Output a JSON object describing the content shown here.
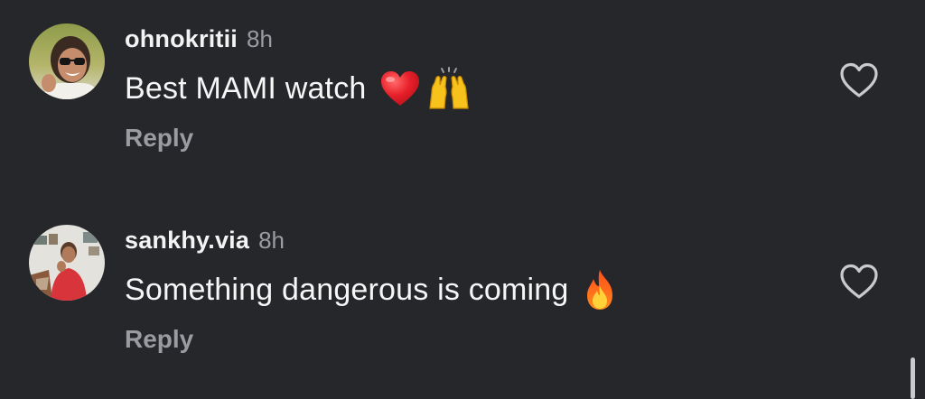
{
  "comments": [
    {
      "username": "ohnokritii",
      "time": "8h",
      "text": "Best MAMI watch",
      "emojis": [
        "red-heart",
        "raising-hands"
      ],
      "reply_label": "Reply",
      "like_icon": "heart-outline-icon"
    },
    {
      "username": "sankhy.via",
      "time": "8h",
      "text": "Something dangerous is coming",
      "emojis": [
        "fire"
      ],
      "reply_label": "Reply",
      "like_icon": "heart-outline-icon"
    }
  ],
  "colors": {
    "background": "#25272b",
    "primary_text": "#f6f6f6",
    "secondary_text": "#9a9ca1"
  }
}
